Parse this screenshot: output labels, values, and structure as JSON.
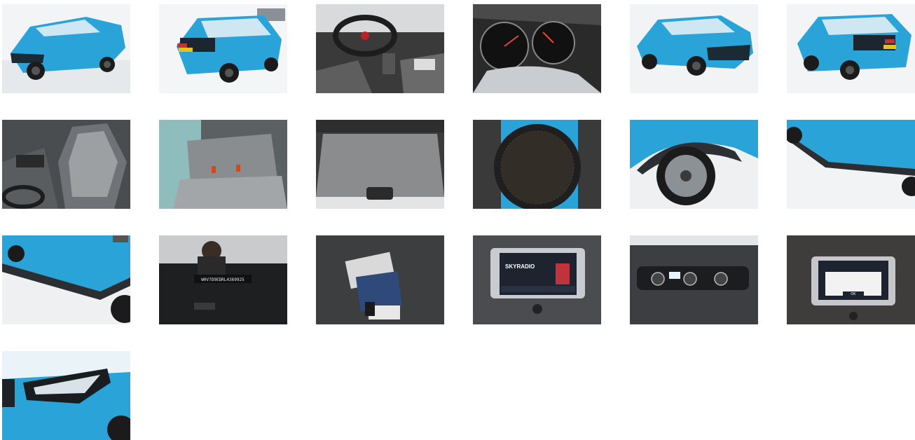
{
  "gallery": {
    "photos": [
      {
        "id": "exterior-front-left",
        "subject": "Blue Opel Crossland X, front three-quarter view"
      },
      {
        "id": "exterior-rear-right",
        "subject": "Blue Opel Crossland X, rear three-quarter view"
      },
      {
        "id": "interior-dashboard",
        "subject": "Steering wheel, gear shift and front seats"
      },
      {
        "id": "instrument-cluster",
        "subject": "Instrument cluster gauges"
      },
      {
        "id": "exterior-front-left-2",
        "subject": "Blue car front three-quarter view"
      },
      {
        "id": "exterior-rear-right-2",
        "subject": "Blue car rear three-quarter view"
      },
      {
        "id": "front-seats",
        "subject": "Front seats upholstery"
      },
      {
        "id": "rear-seats",
        "subject": "Rear bench seat"
      },
      {
        "id": "trunk",
        "subject": "Trunk floor"
      },
      {
        "id": "speaker",
        "subject": "Door speaker grille"
      },
      {
        "id": "wheel",
        "subject": "Alloy wheel and wheel arch"
      },
      {
        "id": "side-panel",
        "subject": "Side door panels"
      },
      {
        "id": "rear-quarter",
        "subject": "Rear quarter panel and wheel"
      },
      {
        "id": "vin-plate",
        "subject": "VIN plate under windshield",
        "vin_text": "W0V7D9EDRL4369925"
      },
      {
        "id": "manuals-keys",
        "subject": "Owner manuals and key"
      },
      {
        "id": "infotainment-radio",
        "subject": "Infotainment screen",
        "screen_text": "SKYRADIO"
      },
      {
        "id": "climate-control",
        "subject": "Climate control panel"
      },
      {
        "id": "infotainment-dialog",
        "subject": "Infotainment dialog",
        "button_text": "OK"
      },
      {
        "id": "headlight",
        "subject": "LED headlight close-up"
      }
    ]
  },
  "colors": {
    "car_blue": "#2aa3d9",
    "car_blue_dark": "#1a7fb3",
    "studio_floor": "#eef0f2",
    "interior_dark": "#2b2b2b",
    "screen_dark": "#1e2330"
  }
}
